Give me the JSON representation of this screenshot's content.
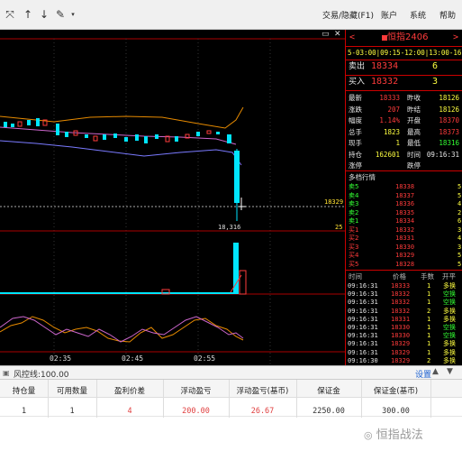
{
  "menu": {
    "trade": "交易/隐藏(F1)",
    "account": "账户",
    "system": "系统",
    "help": "帮助"
  },
  "contract": {
    "name": "恒指2406",
    "nav_prev": "<",
    "nav_next": ">"
  },
  "sessions": "5-03:00|09:15-12:00|13:00-16:3",
  "ask": {
    "label": "卖出",
    "price": "18334",
    "qty": "6"
  },
  "bid": {
    "label": "买入",
    "price": "18332",
    "qty": "3"
  },
  "quote_rows": [
    {
      "l1": "最新",
      "v1": "18333",
      "c1": "red",
      "l2": "昨收",
      "v2": "18126",
      "c2": "yellow"
    },
    {
      "l1": "涨跌",
      "v1": "207",
      "c1": "red",
      "l2": "昨结",
      "v2": "18126",
      "c2": "yellow"
    },
    {
      "l1": "幅度",
      "v1": "1.14%",
      "c1": "red",
      "l2": "开盘",
      "v2": "18370",
      "c2": "red"
    },
    {
      "l1": "总手",
      "v1": "1823",
      "c1": "yellow",
      "l2": "最高",
      "v2": "18373",
      "c2": "red"
    },
    {
      "l1": "现手",
      "v1": "1",
      "c1": "yellow",
      "l2": "最低",
      "v2": "18316",
      "c2": "green"
    },
    {
      "l1": "持仓",
      "v1": "162601",
      "c1": "yellow",
      "l2": "时间",
      "v2": "09:16:31",
      "c2": "white"
    },
    {
      "l1": "涨停",
      "v1": "",
      "c1": "white",
      "l2": "跌停",
      "v2": "",
      "c2": "white"
    }
  ],
  "depth_title": "多档行情",
  "depth": [
    {
      "label": "卖5",
      "price": "18338",
      "qty": "5",
      "side": "sell"
    },
    {
      "label": "卖4",
      "price": "18337",
      "qty": "5",
      "side": "sell"
    },
    {
      "label": "卖3",
      "price": "18336",
      "qty": "4",
      "side": "sell"
    },
    {
      "label": "卖2",
      "price": "18335",
      "qty": "2",
      "side": "sell"
    },
    {
      "label": "卖1",
      "price": "18334",
      "qty": "6",
      "side": "sell"
    },
    {
      "label": "买1",
      "price": "18332",
      "qty": "3",
      "side": "buy"
    },
    {
      "label": "买2",
      "price": "18331",
      "qty": "4",
      "side": "buy"
    },
    {
      "label": "买3",
      "price": "18330",
      "qty": "3",
      "side": "buy"
    },
    {
      "label": "买4",
      "price": "18329",
      "qty": "5",
      "side": "buy"
    },
    {
      "label": "买5",
      "price": "18328",
      "qty": "5",
      "side": "buy"
    }
  ],
  "ticks_header": {
    "time": "时间",
    "price": "价格",
    "qty": "手数",
    "type": "开平"
  },
  "ticks": [
    {
      "time": "09:16:31",
      "price": "18333",
      "qty": "1",
      "type": "多换",
      "tc": "yellow"
    },
    {
      "time": "09:16:31",
      "price": "18332",
      "qty": "1",
      "type": "空换",
      "tc": "green"
    },
    {
      "time": "09:16:31",
      "price": "18332",
      "qty": "1",
      "type": "空换",
      "tc": "green"
    },
    {
      "time": "09:16:31",
      "price": "18332",
      "qty": "2",
      "type": "多换",
      "tc": "yellow"
    },
    {
      "time": "09:16:31",
      "price": "18331",
      "qty": "1",
      "type": "多换",
      "tc": "yellow"
    },
    {
      "time": "09:16:31",
      "price": "18330",
      "qty": "1",
      "type": "空换",
      "tc": "green"
    },
    {
      "time": "09:16:31",
      "price": "18330",
      "qty": "1",
      "type": "空换",
      "tc": "green"
    },
    {
      "time": "09:16:31",
      "price": "18329",
      "qty": "1",
      "type": "多换",
      "tc": "yellow"
    },
    {
      "time": "09:16:31",
      "price": "18329",
      "qty": "1",
      "type": "多换",
      "tc": "yellow"
    },
    {
      "time": "09:16:30",
      "price": "18329",
      "qty": "2",
      "type": "多换",
      "tc": "yellow"
    }
  ],
  "chart": {
    "price_label": "18329",
    "low_label": "18,316",
    "vol_label": "25",
    "time_labels": [
      "02:35",
      "02:45",
      "02:55"
    ]
  },
  "risk": {
    "label": "风控线:100.00",
    "link": "设置"
  },
  "positions": {
    "headers": [
      "持仓量",
      "可用数量",
      "盈利价差",
      "浮动盈亏",
      "浮动盈亏(基币)",
      "保证金",
      "保证金(基币)"
    ],
    "row": [
      "1",
      "1",
      "4",
      "200.00",
      "26.67",
      "2250.00",
      "300.00"
    ]
  },
  "watermark": "恒指战法",
  "colors": {
    "up": "#ff3b3b",
    "down": "#33ff33",
    "candle_up": "#00e5ff",
    "accent": "#c00000"
  }
}
